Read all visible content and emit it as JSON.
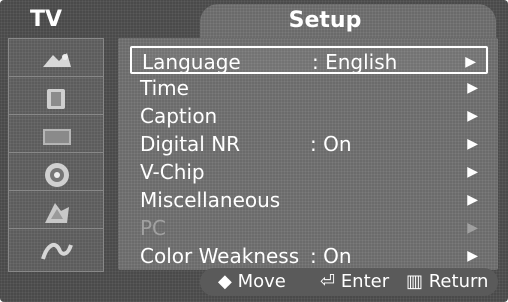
{
  "header": {
    "section": "TV",
    "title": "Setup"
  },
  "sidebar": {
    "items": [
      {
        "icon": "picture-icon"
      },
      {
        "icon": "sound-icon"
      },
      {
        "icon": "channel-icon"
      },
      {
        "icon": "setup-icon"
      },
      {
        "icon": "input-icon"
      },
      {
        "icon": "application-icon"
      }
    ]
  },
  "menu": {
    "items": [
      {
        "label": "Language",
        "value": ": English",
        "arrow": "▶"
      },
      {
        "label": "Time",
        "value": "",
        "arrow": "▶"
      },
      {
        "label": "Caption",
        "value": "",
        "arrow": "▶"
      },
      {
        "label": "Digital NR",
        "value": ": On",
        "arrow": "▶"
      },
      {
        "label": "V-Chip",
        "value": "",
        "arrow": "▶"
      },
      {
        "label": "Miscellaneous",
        "value": "",
        "arrow": "▶"
      },
      {
        "label": "PC",
        "value": "",
        "arrow": "▶"
      },
      {
        "label": "Color Weakness",
        "value": ": On",
        "arrow": "▶"
      }
    ]
  },
  "footer": {
    "move": "Move",
    "enter": "Enter",
    "return": "Return"
  }
}
